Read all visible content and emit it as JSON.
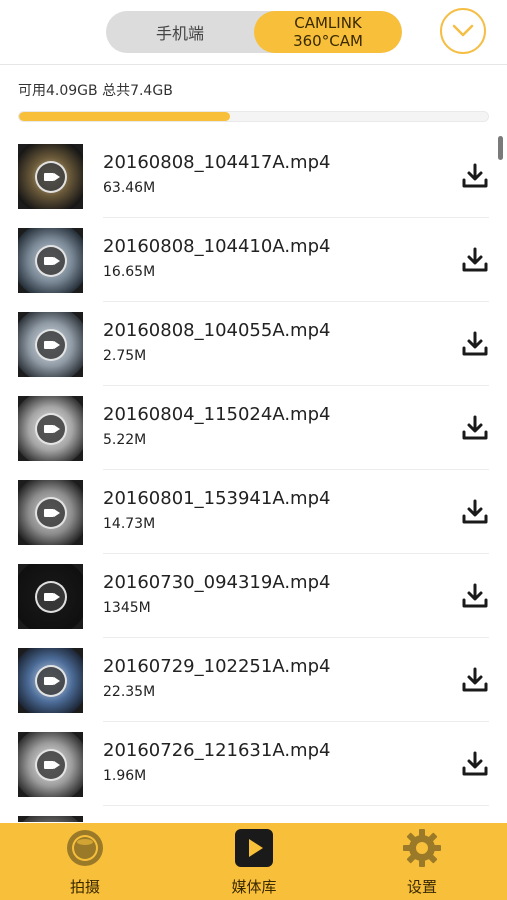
{
  "header": {
    "segments": [
      {
        "label": "手机端",
        "selected": false
      },
      {
        "label_line1": "CAMLINK",
        "label_line2": "360°CAM",
        "selected": true
      }
    ],
    "dropdown_icon": "chevron-down-icon"
  },
  "storage": {
    "text": "可用4.09GB 总共7.4GB",
    "used_fraction": 0.45
  },
  "files": [
    {
      "name": "20160808_104417A.mp4",
      "size": "63.46M"
    },
    {
      "name": "20160808_104410A.mp4",
      "size": "16.65M"
    },
    {
      "name": "20160808_104055A.mp4",
      "size": "2.75M"
    },
    {
      "name": "20160804_115024A.mp4",
      "size": "5.22M"
    },
    {
      "name": "20160801_153941A.mp4",
      "size": "14.73M"
    },
    {
      "name": "20160730_094319A.mp4",
      "size": "1345M"
    },
    {
      "name": "20160729_102251A.mp4",
      "size": "22.35M"
    },
    {
      "name": "20160726_121631A.mp4",
      "size": "1.96M"
    }
  ],
  "tabs": [
    {
      "label": "拍摄",
      "icon": "camera-lens-icon"
    },
    {
      "label": "媒体库",
      "icon": "play-icon",
      "selected": true
    },
    {
      "label": "设置",
      "icon": "gear-icon"
    }
  ],
  "colors": {
    "accent": "#f8bf3a",
    "segment_bg": "#dcdcdc",
    "tab_icon": "#9a7a28"
  }
}
